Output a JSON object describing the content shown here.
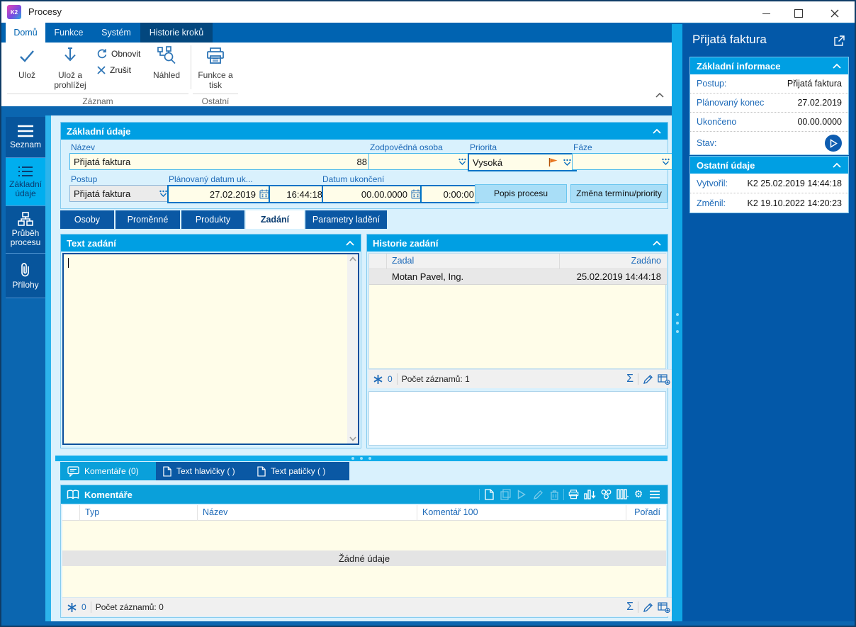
{
  "window": {
    "title": "Procesy",
    "logo": "K2"
  },
  "ribbon": {
    "tabs": [
      {
        "label": "Domů"
      },
      {
        "label": "Funkce"
      },
      {
        "label": "Systém"
      },
      {
        "label": "Historie kroků"
      }
    ],
    "save": "Ulož",
    "save_and_view": "Ulož a prohlížej",
    "refresh": "Obnovit",
    "cancel": "Zrušit",
    "preview": "Náhled",
    "functions_print": "Funkce a tisk",
    "group_record": "Záznam",
    "group_other": "Ostatní"
  },
  "sidebar": {
    "items": [
      {
        "label": "Seznam"
      },
      {
        "label": "Základní údaje"
      },
      {
        "label": "Průběh procesu"
      },
      {
        "label": "Přílohy"
      }
    ]
  },
  "form": {
    "title": "Základní údaje",
    "nazev_label": "Název",
    "nazev_value": "Přijatá faktura",
    "nazev_number": "88",
    "zodpovedna_label": "Zodpovědná osoba",
    "zodpovedna_value": "",
    "priorita_label": "Priorita",
    "priorita_value": "Vysoká",
    "faze_label": "Fáze",
    "faze_value": "",
    "postup_label": "Postup",
    "postup_value": "Přijatá faktura",
    "plan_datum_label": "Plánovaný datum uk...",
    "plan_datum_value": "27.02.2019",
    "plan_cas_value": "16:44:18",
    "ukonceni_label": "Datum ukončení",
    "ukonceni_value": "00.00.0000",
    "ukonceni_cas_value": "0:00:00",
    "btn_popis": "Popis procesu",
    "btn_zmena": "Změna termínu/priority"
  },
  "detail_tabs": [
    {
      "label": "Osoby"
    },
    {
      "label": "Proměnné"
    },
    {
      "label": "Produkty"
    },
    {
      "label": "Zadání"
    },
    {
      "label": "Parametry ladění"
    }
  ],
  "text_zadani": {
    "title": "Text zadání",
    "content": ""
  },
  "historie": {
    "title": "Historie zadání",
    "col_zadal": "Zadal",
    "col_zadano": "Zadáno",
    "rows": [
      {
        "zadal": "Motan Pavel, Ing.",
        "zadano": "25.02.2019 14:44:18"
      }
    ],
    "filter_count": "0",
    "record_count": "Počet záznamů: 1"
  },
  "bottom_tabs": [
    {
      "label": "Komentáře (0)"
    },
    {
      "label": "Text hlavičky ( )"
    },
    {
      "label": "Text patičky ( )"
    }
  ],
  "komentare": {
    "title": "Komentáře",
    "col_typ": "Typ",
    "col_nazev": "Název",
    "col_komentar": "Komentář 100",
    "col_poradi": "Pořadí",
    "empty_text": "Žádné údaje",
    "filter_count": "0",
    "record_count": "Počet záznamů: 0"
  },
  "right_panel": {
    "title": "Přijatá faktura",
    "zakladni_informace": {
      "title": "Základní informace",
      "rows": [
        {
          "label": "Postup:",
          "value": "Přijatá faktura"
        },
        {
          "label": "Plánovaný konec",
          "value": "27.02.2019"
        },
        {
          "label": "Ukončeno",
          "value": "00.00.0000"
        },
        {
          "label": "Stav:",
          "value": ""
        }
      ]
    },
    "ostatni_udaje": {
      "title": "Ostatní údaje",
      "rows": [
        {
          "label": "Vytvořil:",
          "value": "K2 25.02.2019 14:44:18"
        },
        {
          "label": "Změnil:",
          "value": "K2 19.10.2022 14:20:23"
        }
      ]
    }
  },
  "colors": {
    "ribbon_blue": "#0063b1",
    "header_blue": "#009fe3",
    "selection_cyan": "#00aeef",
    "dark_tab_blue": "#0a58a4",
    "window_bg": "#0b66b0",
    "right_panel_bg": "#0358a8",
    "field_cream": "#fffde9",
    "content_bg": "#d9f1fd",
    "flag_orange": "#e87722"
  }
}
